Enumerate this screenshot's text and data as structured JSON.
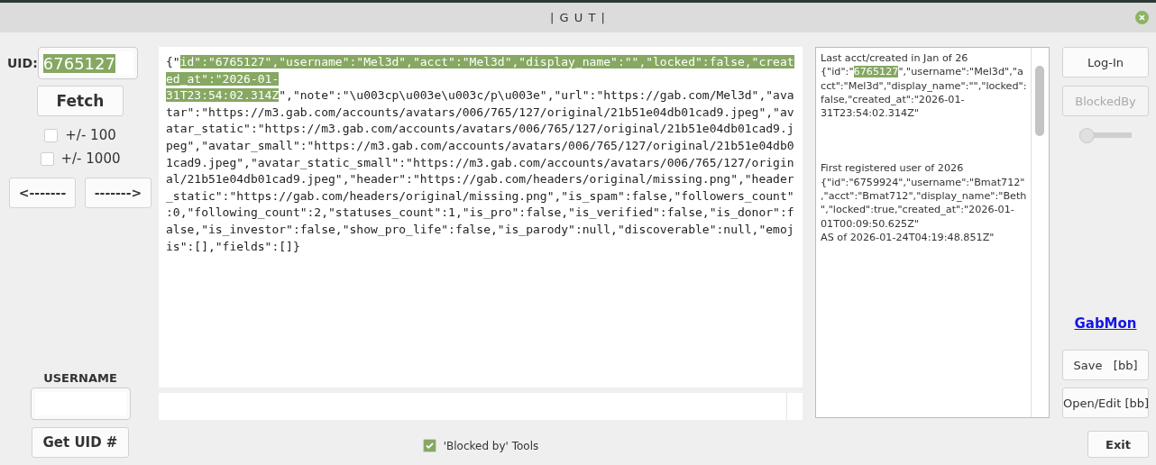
{
  "window": {
    "title": "| G U T |"
  },
  "uid": {
    "label": "UID:",
    "value": "6765127",
    "selected": true
  },
  "fetch_button": "Fetch",
  "range_options": [
    {
      "label": "+/- 100",
      "checked": false
    },
    {
      "label": "+/- 1000",
      "checked": false
    }
  ],
  "nav_buttons": [
    "<-------",
    "------->"
  ],
  "username": {
    "label": "USERNAME"
  },
  "get_uid_button": "Get UID #",
  "json_output": {
    "before": "{\"",
    "selected": "id\":\"6765127\",\"username\":\"Mel3d\",\"acct\":\"Mel3d\",\"display_name\":\"\",\"locked\":false,\"created_at\":\"2026-01-31T23:54:02.314Z",
    "after": "\",\"note\":\"\\u003cp\\u003e\\u003c/p\\u003e\",\"url\":\"https://gab.com/Mel3d\",\"avatar\":\"https://m3.gab.com/accounts/avatars/006/765/127/original/21b51e04db01cad9.jpeg\",\"avatar_static\":\"https://m3.gab.com/accounts/avatars/006/765/127/original/21b51e04db01cad9.jpeg\",\"avatar_small\":\"https://m3.gab.com/accounts/avatars/006/765/127/original/21b51e04db01cad9.jpeg\",\"avatar_static_small\":\"https://m3.gab.com/accounts/avatars/006/765/127/original/21b51e04db01cad9.jpeg\",\"header\":\"https://gab.com/headers/original/missing.png\",\"header_static\":\"https://gab.com/headers/original/missing.png\",\"is_spam\":false,\"followers_count\":0,\"following_count\":2,\"statuses_count\":1,\"is_pro\":false,\"is_verified\":false,\"is_donor\":false,\"is_investor\":false,\"show_pro_life\":false,\"is_parody\":null,\"discoverable\":null,\"emojis\":[],\"fields\":[]}"
  },
  "notes": [
    {
      "heading": "Last acct/created in Jan of 26",
      "before": "{\"id\":\"",
      "selected": "6765127",
      "after": "\",\"username\":\"Mel3d\",\"acct\":\"Mel3d\",\"display_name\":\"\",\"locked\":false,\"created_at\":\"2026-01-31T23:54:02.314Z\""
    },
    {
      "heading": "First registered user of 2026",
      "before": "{\"id\":\"6759924\",\"username\":\"Bmat712\",\"acct\":\"Bmat712\",\"display_name\":\"Beth\",\"locked\":true,\"created_at\":\"2026-01-01T00:09:50.625Z\"",
      "footer": "AS of 2026-01-24T04:19:48.851Z\""
    }
  ],
  "side_buttons": [
    {
      "label": "Log-In",
      "disabled": false
    },
    {
      "label": "BlockedBy",
      "disabled": true
    }
  ],
  "toggle": {
    "on": false
  },
  "link": "GabMon",
  "file_buttons": [
    "Save   [bb]",
    "Open/Edit [bb]"
  ],
  "blocked_tools": {
    "label": "'Blocked by' Tools",
    "checked": true
  },
  "exit_button": "Exit"
}
